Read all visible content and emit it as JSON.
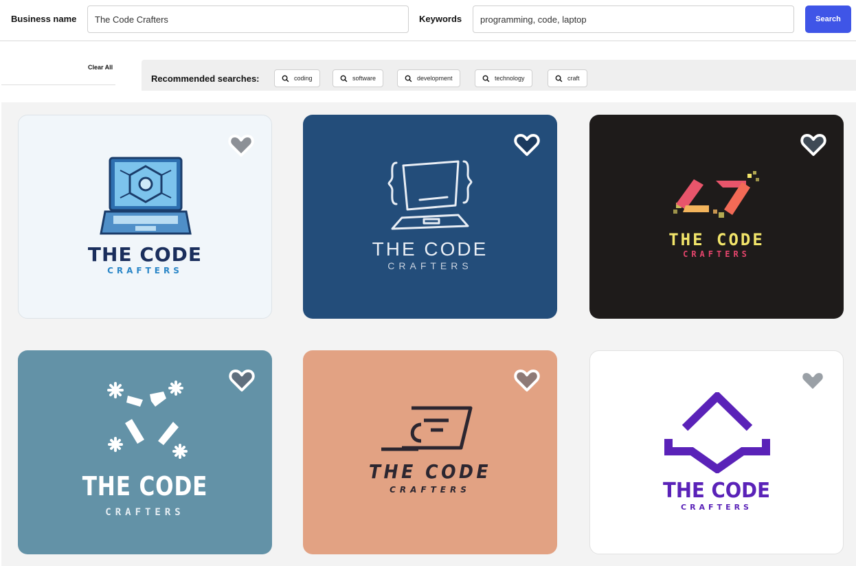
{
  "header": {
    "business_name_label": "Business name",
    "business_name_value": "The Code Crafters",
    "keywords_label": "Keywords",
    "keywords_value": "programming, code, laptop",
    "search_label": "Search"
  },
  "filters": {
    "clear_all_label": "Clear All",
    "recommended_label": "Recommended searches:",
    "chips": [
      "coding",
      "software",
      "development",
      "technology",
      "craft"
    ]
  },
  "colors": {
    "accent": "#3f55e7",
    "card_backgrounds": [
      "#f1f6fa",
      "#234d7a",
      "#1e1b1a",
      "#6392a7",
      "#e2a283",
      "#ffffff"
    ]
  },
  "logos": [
    {
      "title": "THE CODE",
      "subtitle": "CRAFTERS",
      "icon": "laptop-circuit-icon",
      "favorite": false
    },
    {
      "title": "THE CODE",
      "subtitle": "CRAFTERS",
      "icon": "laptop-braces-icon",
      "favorite": false
    },
    {
      "title": "THE CODE",
      "subtitle": "CRAFTERS",
      "icon": "pixel-code-brackets-icon",
      "favorite": false
    },
    {
      "title": "THE CODE",
      "subtitle": "CRAFTERS",
      "icon": "sparkle-brackets-icon",
      "favorite": false
    },
    {
      "title": "THE CODE",
      "subtitle": "CRAFTERS",
      "icon": "slanted-laptop-icon",
      "favorite": false
    },
    {
      "title": "THE CODE",
      "subtitle": "CRAFTERS",
      "icon": "chevron-roof-icon",
      "favorite": false
    }
  ]
}
